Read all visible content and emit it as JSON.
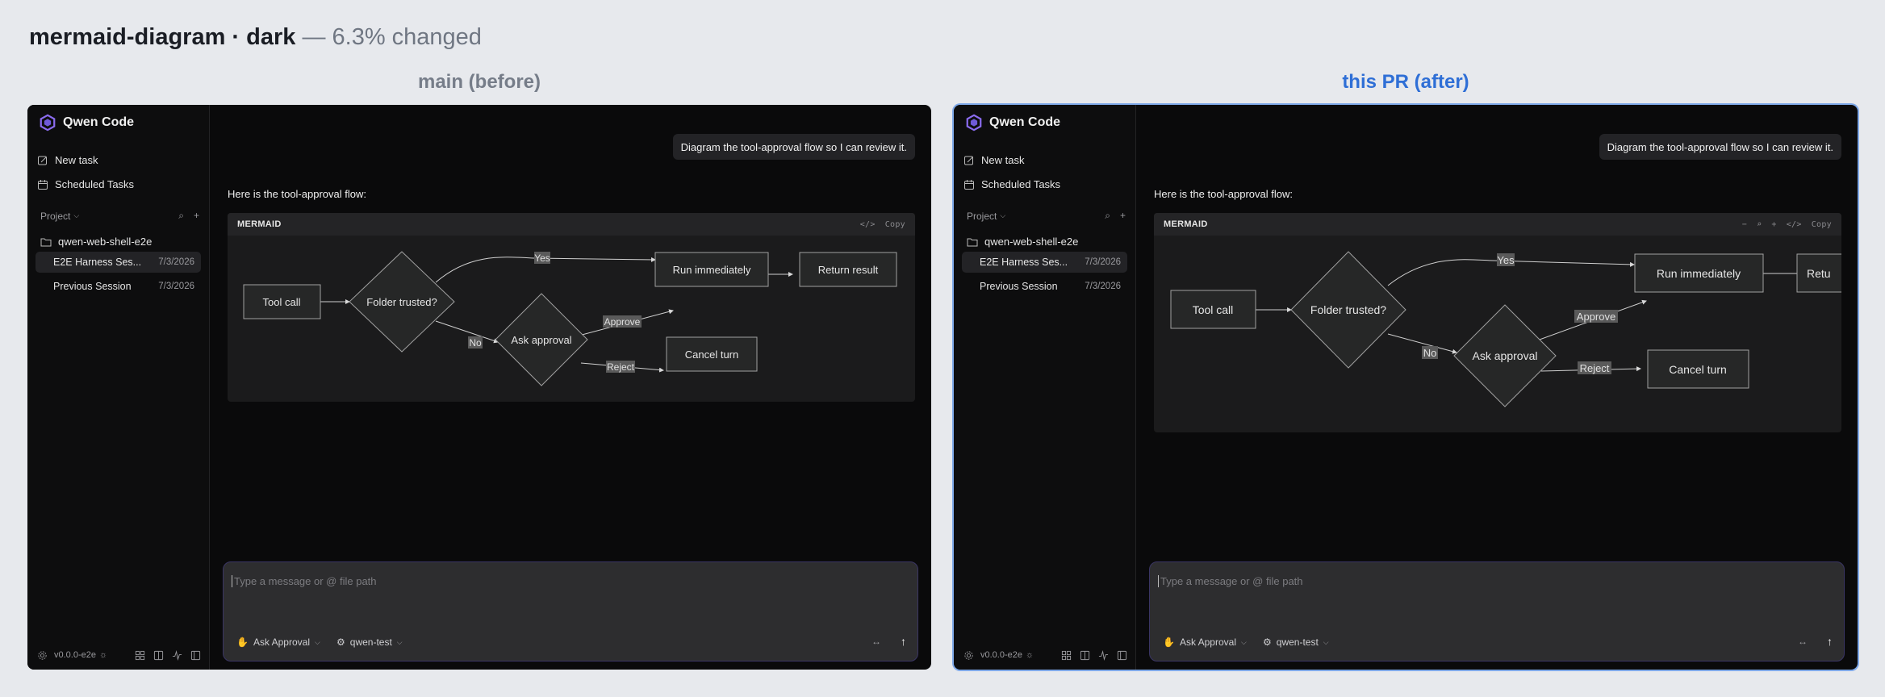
{
  "page": {
    "title_bold": "mermaid-diagram · dark",
    "title_rest": " — 6.3% changed",
    "labels": {
      "before": "main (before)",
      "after": "this PR (after)"
    }
  },
  "app": {
    "name": "Qwen Code",
    "nav": {
      "new_task": "New task",
      "scheduled_tasks": "Scheduled Tasks"
    },
    "project_label": "Project",
    "folder": "qwen-web-shell-e2e",
    "sessions": [
      {
        "name": "E2E Harness Ses...",
        "date": "7/3/2026"
      },
      {
        "name": "Previous Session",
        "date": "7/3/2026"
      }
    ],
    "version": "v0.0.0-e2e",
    "user_message": "Diagram the tool-approval flow so I can review it.",
    "assistant_intro": "Here is the tool-approval flow:",
    "block": {
      "lang": "MERMAID",
      "before_actions": [
        "</>",
        "Copy"
      ],
      "after_actions": [
        "−",
        "⌕",
        "+",
        "</>",
        "Copy"
      ]
    },
    "diagram": {
      "nodes": {
        "tool_call": "Tool call",
        "folder_trusted": "Folder trusted?",
        "ask_approval": "Ask approval",
        "run_immediately": "Run immediately",
        "return_result": "Return result",
        "return_result_clipped": "Retu",
        "cancel_turn": "Cancel turn"
      },
      "edges": {
        "yes": "Yes",
        "no": "No",
        "approve": "Approve",
        "reject": "Reject"
      }
    },
    "composer": {
      "placeholder": "Type a message or @ file path",
      "mode": "Ask Approval",
      "model": "qwen-test"
    }
  },
  "colors": {
    "accent_after": "#2f6fd6",
    "frame_bg": "#0a0a0b",
    "node_stroke": "#9a9a9a"
  }
}
